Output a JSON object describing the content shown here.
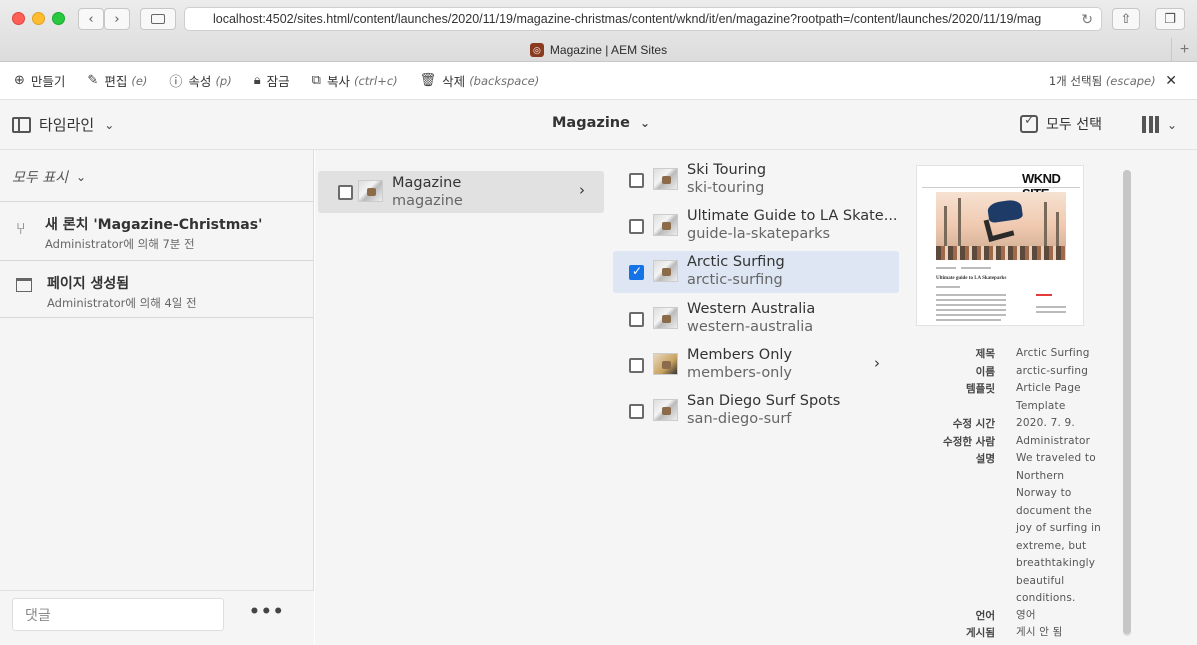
{
  "browser": {
    "url": "localhost:4502/sites.html/content/launches/2020/11/19/magazine-christmas/content/wknd/it/en/magazine?rootpath=/content/launches/2020/11/19/mag",
    "tab_title": "Magazine | AEM Sites"
  },
  "actions": [
    {
      "icon": "plus-circle-icon",
      "label": "만들기",
      "shortcut": ""
    },
    {
      "icon": "pencil-icon",
      "label": "편집",
      "shortcut": "(e)"
    },
    {
      "icon": "info-icon",
      "label": "속성",
      "shortcut": "(p)"
    },
    {
      "icon": "lock-icon",
      "label": "잠금",
      "shortcut": ""
    },
    {
      "icon": "copy-icon",
      "label": "복사",
      "shortcut": "(ctrl+c)"
    },
    {
      "icon": "trash-icon",
      "label": "삭제",
      "shortcut": "(backspace)"
    }
  ],
  "selection": {
    "count_label": "1개 선택됨",
    "shortcut": "(escape)"
  },
  "header": {
    "rail_label": "타임라인",
    "title": "Magazine",
    "select_all": "모두 선택"
  },
  "timeline": {
    "filter": "모두 표시",
    "items": [
      {
        "title": "새 론치 'Magazine-Christmas'",
        "meta": "Administrator에 의해 7분 전",
        "icon": "launch-icon"
      },
      {
        "title": "페이지 생성됨",
        "meta": "Administrator에 의해 4일 전",
        "icon": "page-icon"
      }
    ],
    "comment_placeholder": "댓글"
  },
  "column1": [
    {
      "title": "Magazine",
      "name": "magazine",
      "has_children": true
    }
  ],
  "column2": [
    {
      "title": "Ski Touring",
      "name": "ski-touring",
      "checked": false,
      "has_children": false
    },
    {
      "title": "Ultimate Guide to LA Skate...",
      "name": "guide-la-skateparks",
      "checked": false,
      "has_children": false
    },
    {
      "title": "Arctic Surfing",
      "name": "arctic-surfing",
      "checked": true,
      "has_children": false
    },
    {
      "title": "Western Australia",
      "name": "western-australia",
      "checked": false,
      "has_children": false
    },
    {
      "title": "Members Only",
      "name": "members-only",
      "checked": false,
      "has_children": true
    },
    {
      "title": "San Diego Surf Spots",
      "name": "san-diego-surf",
      "checked": false,
      "has_children": false
    }
  ],
  "preview": {
    "logo": "WKND SITE",
    "heading": "Ultimate guide to LA Skateparks"
  },
  "properties": {
    "title_label": "제목",
    "title_value": "Arctic Surfing",
    "name_label": "이름",
    "name_value": "arctic-surfing",
    "template_label": "템플릿",
    "template_value": "Article Page Template",
    "modified_label": "수정 시간",
    "modified_value": "2020. 7. 9.",
    "modified_by_label": "수정한 사람",
    "modified_by_value": "Administrator",
    "description_label": "설명",
    "description_value": "We traveled to Northern Norway to document the joy of surfing in extreme, but breathtakingly beautiful conditions.",
    "language_label": "언어",
    "language_value": "영어",
    "published_label": "게시됨",
    "published_value": "게시 안 됨"
  }
}
